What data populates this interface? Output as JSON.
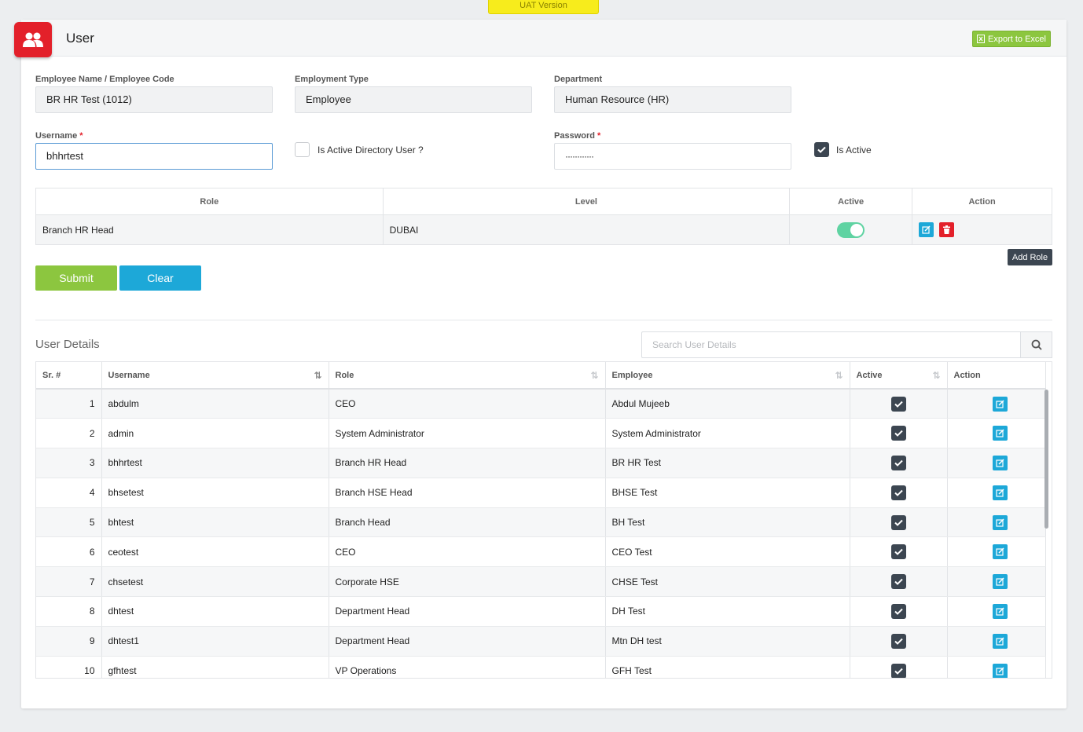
{
  "env_badge": "UAT Version",
  "header": {
    "title": "User",
    "export_label": "Export to Excel",
    "page_icon": "users-icon"
  },
  "form": {
    "employee_name_label": "Employee Name / Employee Code",
    "employee_name_value": "BR HR Test (1012)",
    "employment_type_label": "Employment Type",
    "employment_type_value": "Employee",
    "department_label": "Department",
    "department_value": "Human Resource (HR)",
    "username_label": "Username",
    "username_value": "bhhrtest",
    "ad_user_label": "Is Active Directory User ?",
    "ad_user_checked": false,
    "password_label": "Password",
    "password_value": "············",
    "is_active_label": "Is Active",
    "is_active_checked": true,
    "required_mark": "*"
  },
  "role_table": {
    "headers": [
      "Role",
      "Level",
      "Active",
      "Action"
    ],
    "rows": [
      {
        "role": "Branch HR Head",
        "level": "DUBAI",
        "active": true
      }
    ]
  },
  "buttons": {
    "add_role": "Add Role",
    "submit": "Submit",
    "clear": "Clear"
  },
  "user_details": {
    "title": "User Details",
    "search_placeholder": "Search User Details",
    "headers": [
      "Sr. #",
      "Username",
      "Role",
      "Employee",
      "Active",
      "Action"
    ],
    "rows": [
      {
        "sr": "1",
        "username": "abdulm",
        "role": "CEO",
        "employee": "Abdul Mujeeb",
        "active": true
      },
      {
        "sr": "2",
        "username": "admin",
        "role": "System Administrator",
        "employee": "System Administrator",
        "active": true
      },
      {
        "sr": "3",
        "username": "bhhrtest",
        "role": "Branch HR Head",
        "employee": "BR HR Test",
        "active": true
      },
      {
        "sr": "4",
        "username": "bhsetest",
        "role": "Branch HSE Head",
        "employee": "BHSE Test",
        "active": true
      },
      {
        "sr": "5",
        "username": "bhtest",
        "role": "Branch Head",
        "employee": "BH Test",
        "active": true
      },
      {
        "sr": "6",
        "username": "ceotest",
        "role": "CEO",
        "employee": "CEO Test",
        "active": true
      },
      {
        "sr": "7",
        "username": "chsetest",
        "role": "Corporate HSE",
        "employee": "CHSE Test",
        "active": true
      },
      {
        "sr": "8",
        "username": "dhtest",
        "role": "Department Head",
        "employee": "DH Test",
        "active": true
      },
      {
        "sr": "9",
        "username": "dhtest1",
        "role": "Department Head",
        "employee": "Mtn DH test",
        "active": true
      },
      {
        "sr": "10",
        "username": "gfhtest",
        "role": "VP Operations",
        "employee": "GFH Test",
        "active": true
      }
    ]
  },
  "colors": {
    "brand_red": "#e3202a",
    "green": "#8cc63f",
    "blue": "#1da8d8",
    "dark": "#3c4651",
    "toggle_on": "#5fd3a2"
  }
}
